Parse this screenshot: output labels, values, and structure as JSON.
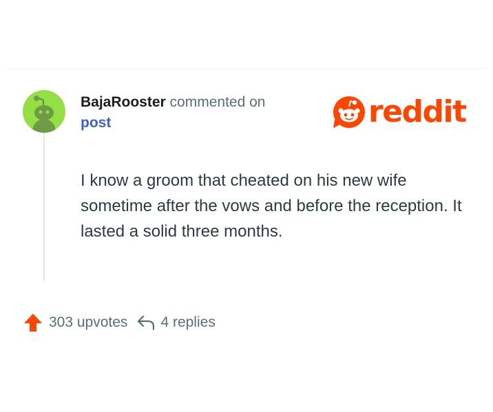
{
  "comment": {
    "username": "BajaRooster",
    "action_text": "commented on",
    "target_link": "post",
    "body": "I know a groom that cheated on his new wife sometime after the vows and before the reception. It lasted a solid three months."
  },
  "branding": {
    "logo_text": "reddit",
    "brand_color": "#ff4500"
  },
  "footer": {
    "upvotes_label": "303 upvotes",
    "replies_label": "4 replies"
  },
  "avatar": {
    "background_color": "#94e044",
    "icon": "snoo-avatar-icon"
  },
  "icons": {
    "upvote": "upvote-arrow-icon",
    "reply": "reply-arrow-icon",
    "logo": "reddit-snoo-icon"
  }
}
